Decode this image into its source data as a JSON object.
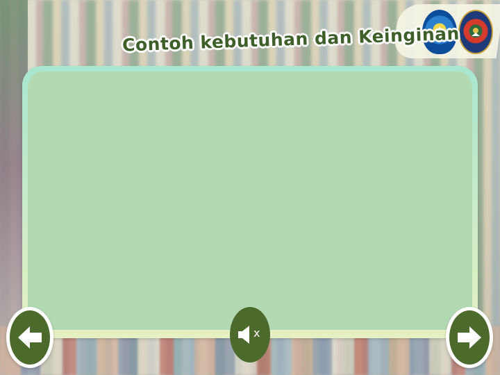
{
  "slide": {
    "title": "Contoh kebutuhan dan Keinginan"
  },
  "logos": [
    {
      "name": "kemdikbud-logo"
    },
    {
      "name": "regional-logo"
    }
  ],
  "controls": {
    "prev_icon": "arrow-left-icon",
    "sound_icon": "speaker-muted-icon",
    "sound_state": "muted",
    "next_icon": "arrow-right-icon",
    "mute_glyph": "x"
  },
  "colors": {
    "button_fill": "#4b6a2c",
    "panel_fill": "#b3d9b3",
    "title_color": "#3e5f2a"
  }
}
